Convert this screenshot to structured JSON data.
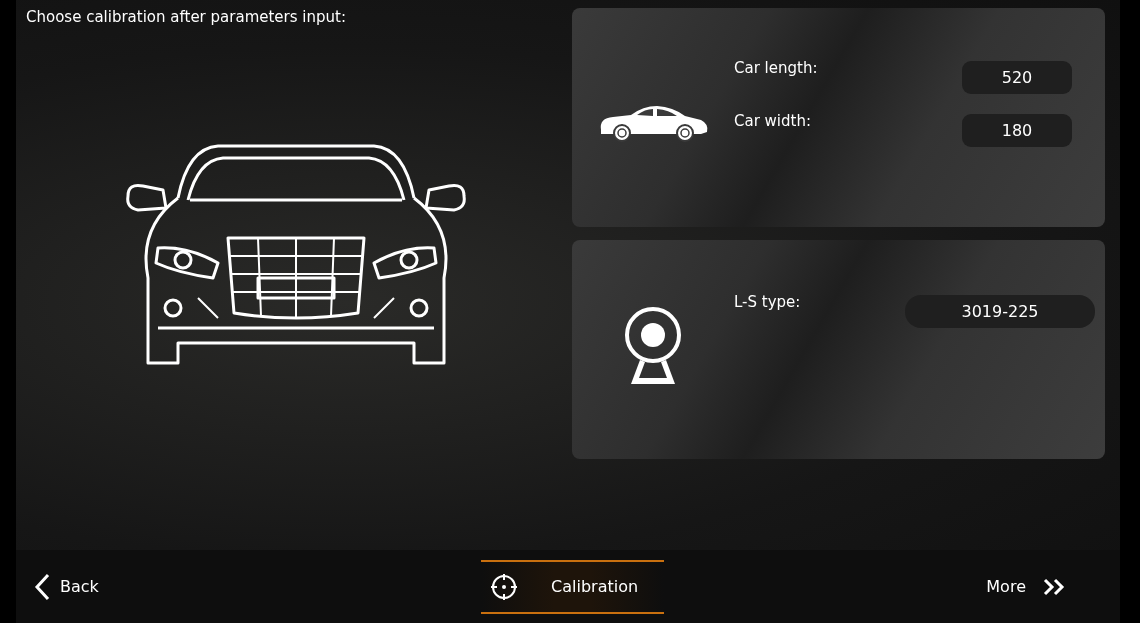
{
  "title": "Choose calibration after parameters input:",
  "cards": [
    {
      "kind": "vehicle",
      "fields": [
        {
          "label": "Car length:",
          "value": "520"
        },
        {
          "label": "Car width:",
          "value": "180"
        }
      ]
    },
    {
      "kind": "sensor",
      "fields": [
        {
          "label": "L-S type:",
          "value": "3019-225"
        }
      ]
    }
  ],
  "nav": [
    {
      "kind": "back",
      "label": "Back",
      "selected": false
    },
    {
      "kind": "calibration",
      "label": "Calibration",
      "selected": true
    },
    {
      "kind": "more",
      "label": "More",
      "selected": false
    }
  ]
}
